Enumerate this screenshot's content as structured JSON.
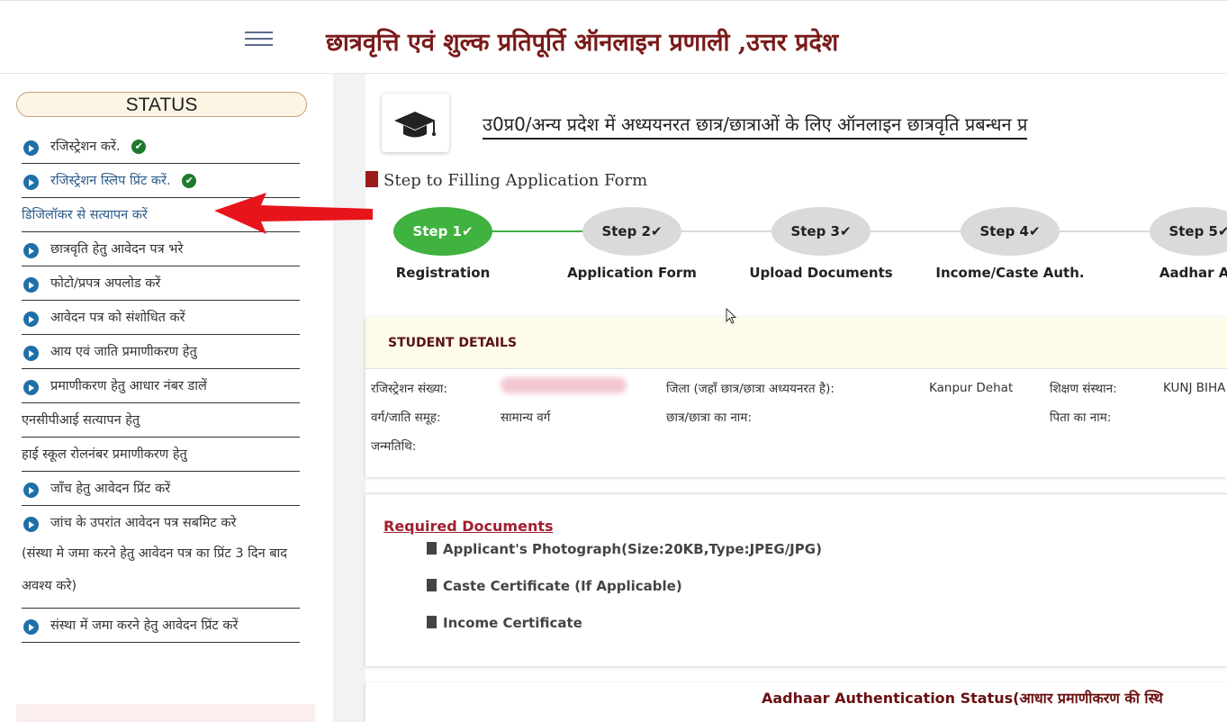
{
  "header": {
    "title": "छात्रवृत्ति एवं शुल्क प्रतिपूर्ति ऑनलाइन प्रणाली ,उत्तर प्रदेश"
  },
  "sidebar": {
    "status_label": "STATUS",
    "items": [
      {
        "label": "रजिस्ट्रेशन करें.",
        "checked": true
      },
      {
        "label": "रजिस्ट्रेशन स्लिप प्रिंट करें.",
        "checked": true
      },
      {
        "label": "डिजिलॉकर से सत्यापन करें"
      },
      {
        "label": "छात्रवृति हेतु आवेदन पत्र भरे"
      },
      {
        "label": "फोटो/प्रपत्र अपलोड करें"
      },
      {
        "label": "आवेदन पत्र को संशोधित करें"
      },
      {
        "label": "आय एवं जाति प्रमाणीकरण हेतु"
      },
      {
        "label": "प्रमाणीकरण हेतु आधार नंबर डालें"
      },
      {
        "label": "एनसीपीआई सत्यापन हेतु"
      },
      {
        "label": "हाई स्कूल रोलनंबर प्रमाणीकरण हेतु"
      },
      {
        "label": "जाँच हेतु आवेदन प्रिंट करें"
      },
      {
        "label": "जांच के उपरांत आवेदन पत्र सबमिट करे",
        "note": "(संस्था मे जमा करने हेतु आवेदन पत्र का प्रिंट 3 दिन बाद अवश्य करे)"
      },
      {
        "label": "संस्था में जमा करने हेतु आवेदन प्रिंट करें"
      }
    ]
  },
  "main": {
    "heading": "उ0प्र0/अन्य प्रदेश में अध्ययनरत छात्र/छात्राओं के लिए ऑनलाइन छात्रवृति प्रबन्धन प्र",
    "steps_title": "Step to Filling Application Form",
    "steps": [
      {
        "circle": "Step 1",
        "label": "Registration",
        "active": true
      },
      {
        "circle": "Step 2",
        "label": "Application Form"
      },
      {
        "circle": "Step 3",
        "label": "Upload Documents"
      },
      {
        "circle": "Step 4",
        "label": "Income/Caste Auth."
      },
      {
        "circle": "Step 5",
        "label": "Aadhar Au"
      }
    ],
    "check_mark": "✔",
    "student": {
      "heading": "STUDENT DETAILS",
      "reg_label": "रजिस्ट्रेशन संख्या:",
      "district_label": "जिला (जहाँ छात्र/छात्रा अध्ययनरत है):",
      "district_value": "Kanpur Dehat",
      "institute_label": "शिक्षण संस्थान:",
      "institute_value": "KUNJ BIHA",
      "caste_label": "वर्ग/जाति समूह:",
      "caste_value": "सामान्य वर्ग",
      "student_name_label": "छात्र/छात्रा का नाम:",
      "father_name_label": "पिता का नाम:",
      "dob_label": "जन्मतिथि:"
    },
    "documents": {
      "title": "Required Documents",
      "items": [
        "Applicant's Photograph(Size:20KB,Type:JPEG/JPG)",
        "Caste Certificate (If Applicable)",
        "Income Certificate"
      ]
    },
    "aadhaar_title": "Aadhaar Authentication Status(आधार प्रमाणीकरण की स्थि"
  },
  "colors": {
    "title_maroon": "#7a1a1a",
    "step_active": "#3fb23f",
    "step_inactive": "#dadada",
    "bullet_blue": "#1f6fa8",
    "check_green": "#1e7a2e",
    "annotation_red": "#e8141c"
  }
}
